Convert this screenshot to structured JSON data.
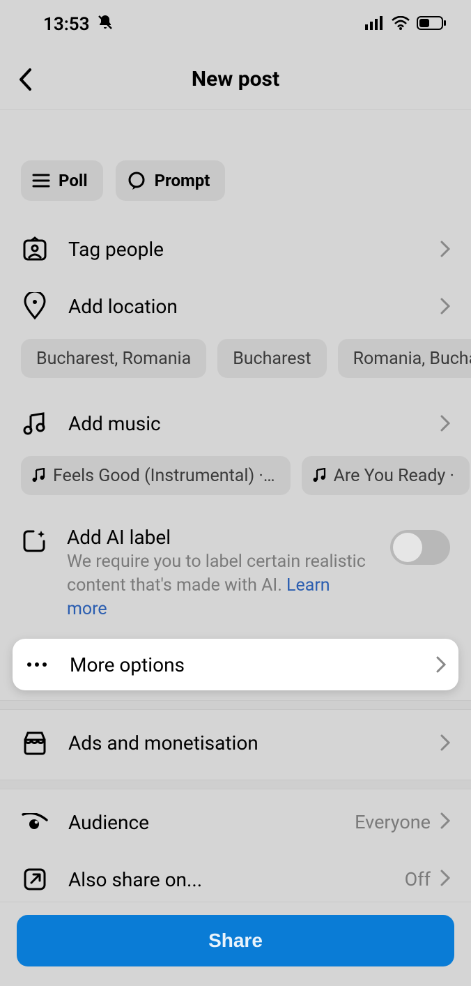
{
  "status": {
    "time": "13:53"
  },
  "header": {
    "title": "New post"
  },
  "pills": {
    "poll": "Poll",
    "prompt": "Prompt"
  },
  "rows": {
    "tag_people": "Tag people",
    "add_location": "Add location",
    "add_music": "Add music",
    "ai_label_title": "Add AI label",
    "ai_label_desc": "We require you to label certain realistic content that's made with AI. ",
    "ai_label_learn_more": "Learn more",
    "more_options": "More options",
    "ads": "Ads and monetisation",
    "audience": "Audience",
    "audience_value": "Everyone",
    "also_share": "Also share on...",
    "also_share_value": "Off"
  },
  "location_suggestions": [
    "Bucharest, Romania",
    "Bucharest",
    "Romania, Buchare"
  ],
  "music_suggestions": [
    {
      "label": "Feels Good (Instrumental) ·…"
    },
    {
      "label": "Are You Ready ·"
    }
  ],
  "ai_toggle_on": false,
  "share_button": "Share"
}
